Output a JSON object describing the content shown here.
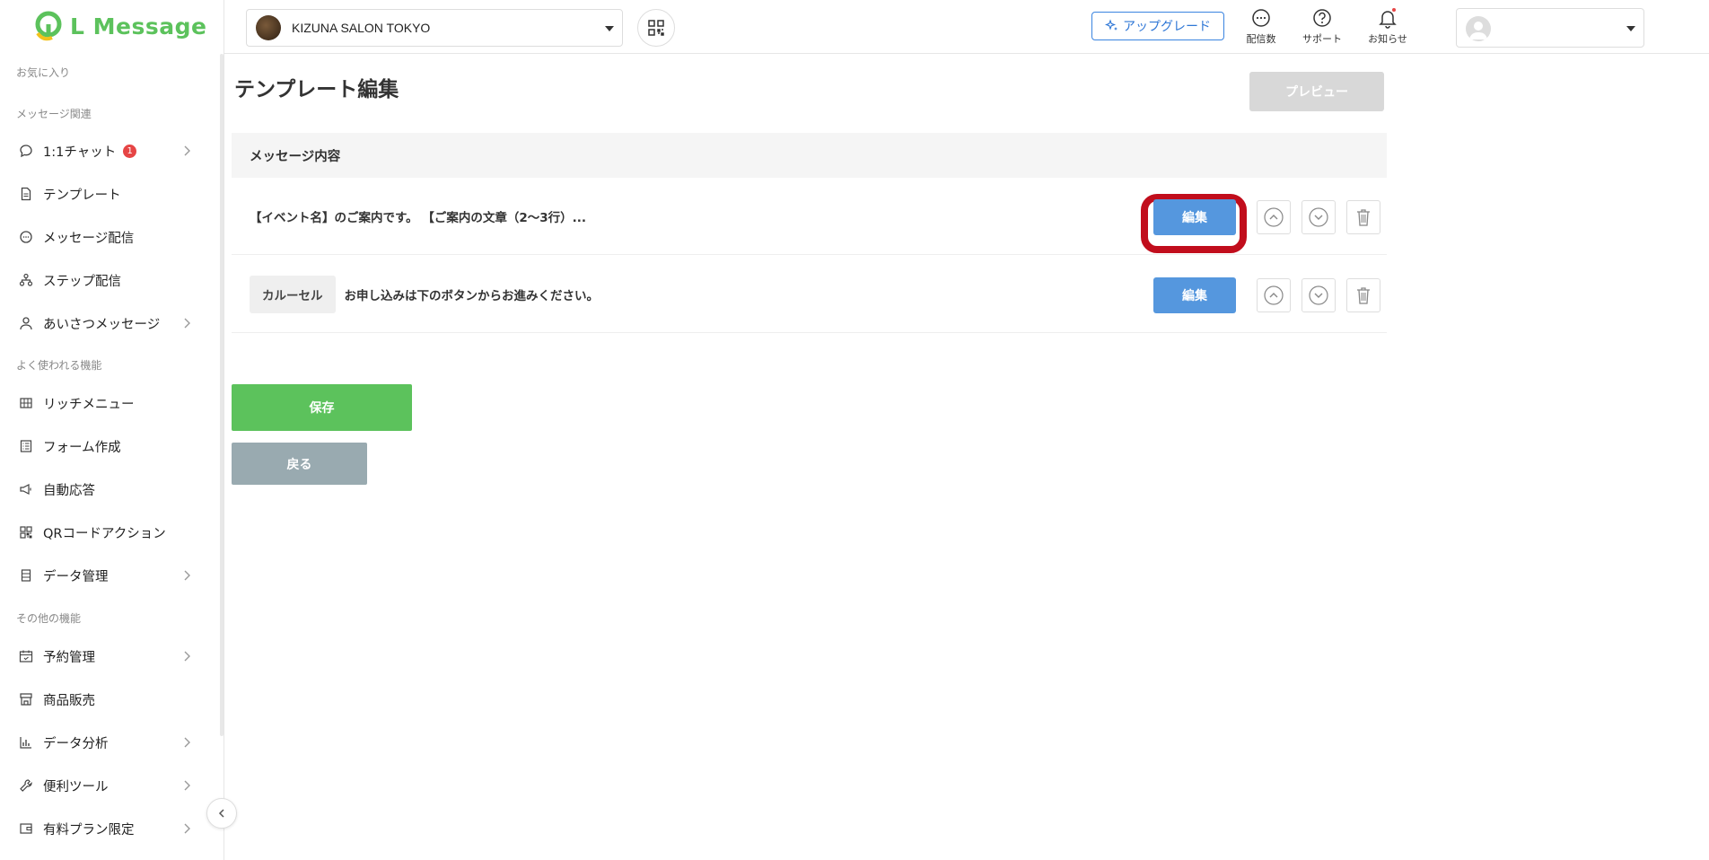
{
  "brand": {
    "name": "L Message",
    "accent": "#5cc25c"
  },
  "header": {
    "account_name": "KIZUNA SALON TOKYO",
    "upgrade_label": "アップグレード",
    "icons": [
      {
        "label": "配信数",
        "icon": "message-count-icon"
      },
      {
        "label": "サポート",
        "icon": "support-icon"
      },
      {
        "label": "お知らせ",
        "icon": "bell-icon"
      }
    ]
  },
  "sidebar": {
    "sections": {
      "favorites": "お気に入り",
      "message": "メッセージ関連",
      "common": "よく使われる機能",
      "other": "その他の機能"
    },
    "items": [
      {
        "label": "1:1チャット",
        "badge": "1",
        "icon": "chat-icon"
      },
      {
        "label": "テンプレート",
        "icon": "document-icon"
      },
      {
        "label": "メッセージ配信",
        "icon": "message-icon"
      },
      {
        "label": "ステップ配信",
        "icon": "step-icon"
      },
      {
        "label": "あいさつメッセージ",
        "icon": "person-icon"
      },
      {
        "label": "リッチメニュー",
        "icon": "grid-icon"
      },
      {
        "label": "フォーム作成",
        "icon": "form-icon"
      },
      {
        "label": "自動応答",
        "icon": "megaphone-icon"
      },
      {
        "label": "QRコードアクション",
        "icon": "qr-icon"
      },
      {
        "label": "データ管理",
        "icon": "database-icon"
      },
      {
        "label": "予約管理",
        "icon": "calendar-icon"
      },
      {
        "label": "商品販売",
        "icon": "store-icon"
      },
      {
        "label": "データ分析",
        "icon": "chart-icon"
      },
      {
        "label": "便利ツール",
        "icon": "wrench-icon"
      },
      {
        "label": "有料プラン限定",
        "icon": "wallet-icon"
      }
    ]
  },
  "main": {
    "title": "テンプレート編集",
    "preview_label": "プレビュー",
    "content_header": "メッセージ内容",
    "rows": [
      {
        "tag": "",
        "text": "【イベント名】のご案内です。 【ご案内の文章（2〜3行）...",
        "edit_label": "編集"
      },
      {
        "tag": "カルーセル",
        "text": "お申し込みは下のボタンからお進みください。",
        "edit_label": "編集"
      }
    ],
    "save_label": "保存",
    "back_label": "戻る"
  }
}
